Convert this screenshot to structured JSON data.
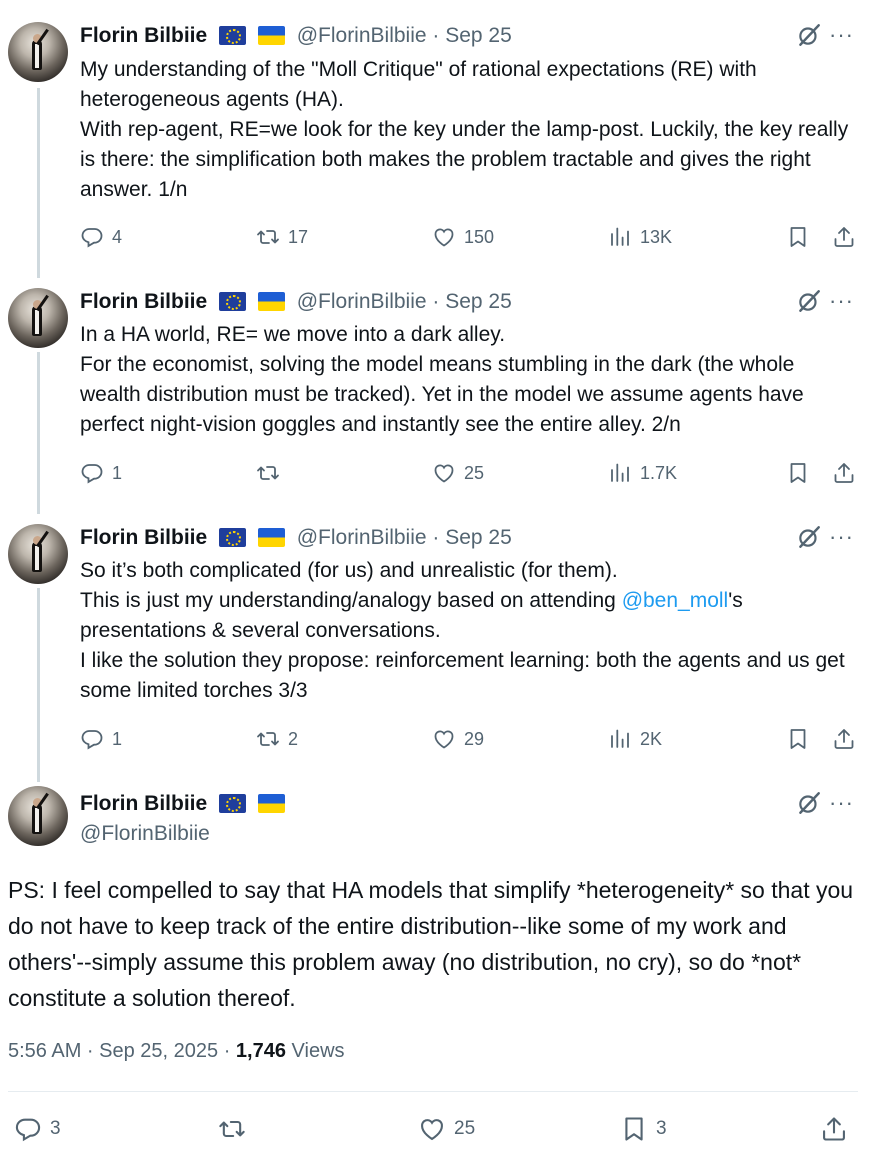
{
  "user": {
    "name": "Florin Bilbiie",
    "handle": "@FlorinBilbiie"
  },
  "tweets": [
    {
      "date": "Sep 25",
      "lines": [
        "My understanding of the \"Moll Critique\" of rational expectations (RE) with heterogeneous agents (HA).",
        "With rep-agent, RE=we look for the key under the lamp-post. Luckily, the key really is there: the simplification both makes the problem tractable and gives the right answer. 1/n"
      ],
      "replies": "4",
      "reposts": "17",
      "likes": "150",
      "views": "13K"
    },
    {
      "date": "Sep 25",
      "lines": [
        "In a HA world, RE= we move into a dark alley.",
        "For the economist, solving the model means stumbling in the dark (the whole wealth distribution must be tracked). Yet in the model we assume agents have perfect night-vision goggles and instantly see the entire alley. 2/n"
      ],
      "replies": "1",
      "reposts": "",
      "likes": "25",
      "views": "1.7K"
    },
    {
      "date": "Sep 25",
      "line1": "So it’s both complicated (for us) and unrealistic (for them).",
      "line2_before": "This is just my understanding/analogy based on attending ",
      "mention": "@ben_moll",
      "line2_after": "'s presentations & several conversations.",
      "line3": "I like the solution they propose: reinforcement learning: both the agents and us get some limited torches 3/3",
      "replies": "1",
      "reposts": "2",
      "likes": "29",
      "views": "2K"
    }
  ],
  "main": {
    "text": "PS: I feel compelled to say that HA models that simplify *heterogeneity* so that you do not have to keep track of the entire distribution--like some of my work and others'--simply assume this problem away (no distribution, no cry), so do *not* constitute a solution thereof.",
    "time": "5:56 AM · Sep 25, 2025 · ",
    "views_count": "1,746",
    "views_label": " Views",
    "replies": "3",
    "likes": "25",
    "bookmarks": "3"
  },
  "ui": {
    "separator": " · ",
    "more": "···"
  },
  "icons": [
    "reply-icon",
    "repost-icon",
    "like-icon",
    "views-icon",
    "bookmark-icon",
    "share-icon",
    "grok-icon",
    "more-icon"
  ],
  "colors": {
    "text": "#0f1419",
    "secondary": "#536471",
    "link": "#1d9bf0",
    "thread": "#cfd9de",
    "eu_flag": "#1f3e9c",
    "ua_blue": "#1e5ed4",
    "ua_yellow": "#ffd500"
  }
}
